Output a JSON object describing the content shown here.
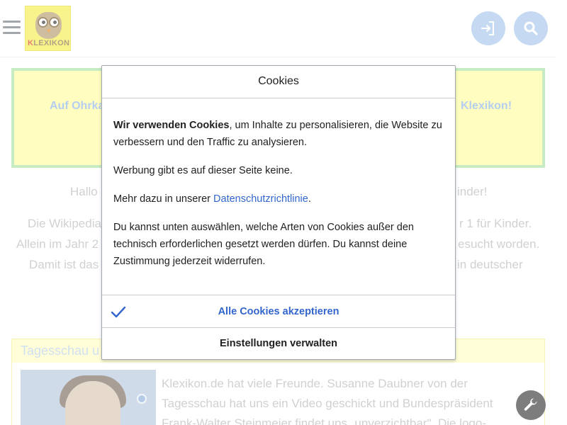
{
  "header": {
    "logo_text_k": "K",
    "logo_text_rest": "LEXIKON",
    "menu_icon": "hamburger-menu-icon",
    "login_icon": "login-icon",
    "search_icon": "search-icon"
  },
  "banner": {
    "left_text": "Auf Ohrka",
    "right_text": "Klexikon!"
  },
  "intro": {
    "greeting_left": "Hallo",
    "greeting_right": "inder!",
    "lines_left": [
      "Die Wikipedia",
      "Allein im Jahr 2",
      "Damit ist das"
    ],
    "lines_right": [
      "r 1 für Kinder.",
      "esucht worden.",
      "in deutscher"
    ]
  },
  "tagesschau": {
    "title": "Tagesschau u",
    "text_lines": [
      "Klexikon.de hat viele Freunde. Susanne Daubner von der",
      "Tagesschau hat uns ein Video geschickt und Bundespräsident",
      "Frank-Walter Steinmeier findet uns „unverzichtbar\". Die logo-"
    ]
  },
  "cookie_dialog": {
    "title": "Cookies",
    "p1_bold": "Wir verwenden Cookies",
    "p1_rest": ", um Inhalte zu personalisieren, die Website zu verbessern und den Traffic zu analysieren.",
    "p2": "Werbung gibt es auf dieser Seite keine.",
    "p3_prefix": "Mehr dazu in unserer ",
    "p3_link": "Datenschutzrichtlinie",
    "p3_suffix": ".",
    "p4": "Du kannst unten auswählen, welche Arten von Cookies außer den technisch erforderlichen gesetzt werden dürfen. Du kannst deine Zustimmung jederzeit widerrufen.",
    "accept_label": "Alle Cookies akzeptieren",
    "manage_label": "Einstellungen verwalten"
  },
  "colors": {
    "accent_blue": "#3366cc",
    "header_button_blue": "#a7c6ec",
    "banner_yellow": "#fffe9f",
    "banner_border_green": "#a9e0a2"
  }
}
